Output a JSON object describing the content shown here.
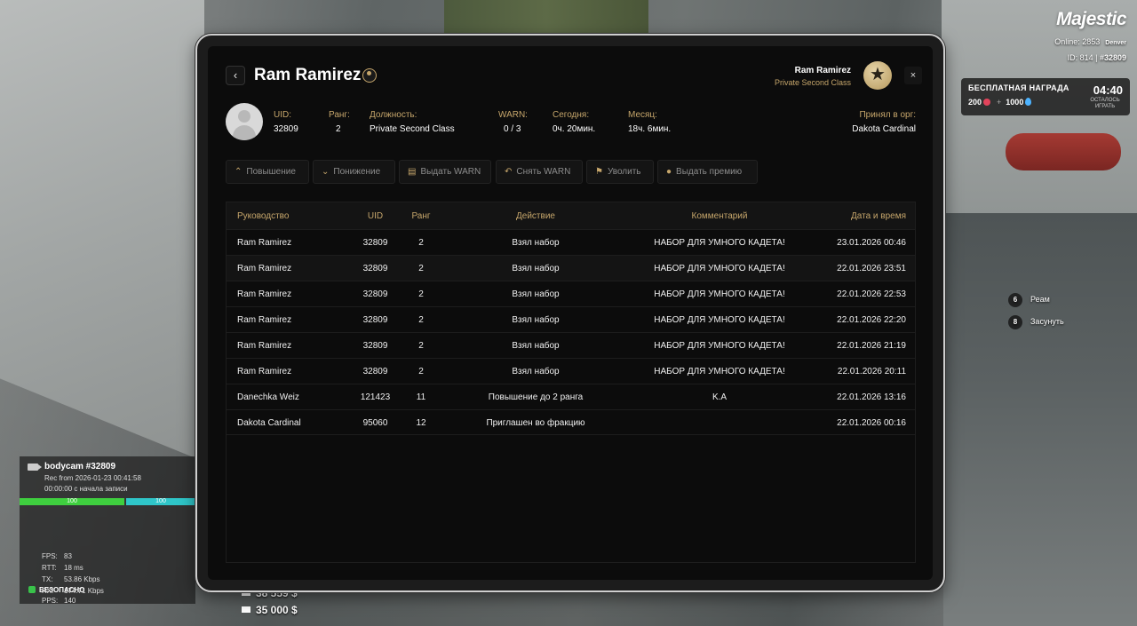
{
  "hud": {
    "logo": "Majestic",
    "online": "Online: 2853",
    "server": "Denver",
    "id_prefix": "ID: 814 | ",
    "id_value": "#32809",
    "reward_title": "БЕСПЛАТНАЯ НАГРАДА",
    "reward_coins": "200",
    "reward_plus": "+",
    "reward_drops": "1000",
    "reward_time": "04:40",
    "reward_sub": "ОСТАЛОСЬ ИГРАТЬ",
    "key_hints": [
      {
        "key": "6",
        "label": "Реам"
      },
      {
        "key": "8",
        "label": "Засунуть"
      }
    ],
    "bodycam": {
      "title": "bodycam #32809",
      "rec": "Rec from 2026-01-23 00:41:58",
      "elapsed": "00:00:00 с начала записи",
      "bar1": "100",
      "bar2": "100"
    },
    "stats": [
      {
        "k": "FPS:",
        "v": "83"
      },
      {
        "k": "RTT:",
        "v": "18 ms"
      },
      {
        "k": "TX:",
        "v": "53.86 Kbps"
      },
      {
        "k": "RX:",
        "v": "174.71 Kbps"
      },
      {
        "k": "PPS:",
        "v": "140"
      }
    ],
    "safe": "БЕЗОПАСНО",
    "cash": "38 559 $",
    "bank": "35 000 $"
  },
  "header": {
    "name": "Ram Ramirez",
    "user_name": "Ram Ramirez",
    "user_rank": "Private Second Class",
    "badge_icon": "★",
    "close": "×",
    "back": "‹"
  },
  "info": {
    "uid_label": "UID:",
    "uid": "32809",
    "rank_label": "Ранг:",
    "rank": "2",
    "position_label": "Должность:",
    "position": "Private Second Class",
    "warn_label": "WARN:",
    "warn": "0 / 3",
    "today_label": "Сегодня:",
    "today": "0ч. 20мин.",
    "month_label": "Месяц:",
    "month": "18ч. 6мин.",
    "accepted_label": "Принял в орг:",
    "accepted": "Dakota Cardinal"
  },
  "actions": [
    {
      "label": "Повышение",
      "icon": "⌃"
    },
    {
      "label": "Понижение",
      "icon": "⌄"
    },
    {
      "label": "Выдать WARN",
      "icon": "▤"
    },
    {
      "label": "Снять WARN",
      "icon": "↶"
    },
    {
      "label": "Уволить",
      "icon": "⚑"
    },
    {
      "label": "Выдать премию",
      "icon": "●"
    }
  ],
  "table": {
    "headers": [
      "Руководство",
      "UID",
      "Ранг",
      "Действие",
      "Комментарий",
      "Дата и время"
    ],
    "rows": [
      [
        "Ram Ramirez",
        "32809",
        "2",
        "Взял набор",
        "НАБОР ДЛЯ УМНОГО КАДЕТА!",
        "23.01.2026 00:46"
      ],
      [
        "Ram Ramirez",
        "32809",
        "2",
        "Взял набор",
        "НАБОР ДЛЯ УМНОГО КАДЕТА!",
        "22.01.2026 23:51"
      ],
      [
        "Ram Ramirez",
        "32809",
        "2",
        "Взял набор",
        "НАБОР ДЛЯ УМНОГО КАДЕТА!",
        "22.01.2026 22:53"
      ],
      [
        "Ram Ramirez",
        "32809",
        "2",
        "Взял набор",
        "НАБОР ДЛЯ УМНОГО КАДЕТА!",
        "22.01.2026 22:20"
      ],
      [
        "Ram Ramirez",
        "32809",
        "2",
        "Взял набор",
        "НАБОР ДЛЯ УМНОГО КАДЕТА!",
        "22.01.2026 21:19"
      ],
      [
        "Ram Ramirez",
        "32809",
        "2",
        "Взял набор",
        "НАБОР ДЛЯ УМНОГО КАДЕТА!",
        "22.01.2026 20:11"
      ],
      [
        "Danechka Weiz",
        "121423",
        "11",
        "Повышение до 2 ранга",
        "K.A",
        "22.01.2026 13:16"
      ],
      [
        "Dakota Cardinal",
        "95060",
        "12",
        "Приглашен во фракцию",
        "",
        "22.01.2026 00:16"
      ]
    ]
  },
  "colors": {
    "accent": "#c6a66b",
    "bg": "#0c0c0c"
  }
}
